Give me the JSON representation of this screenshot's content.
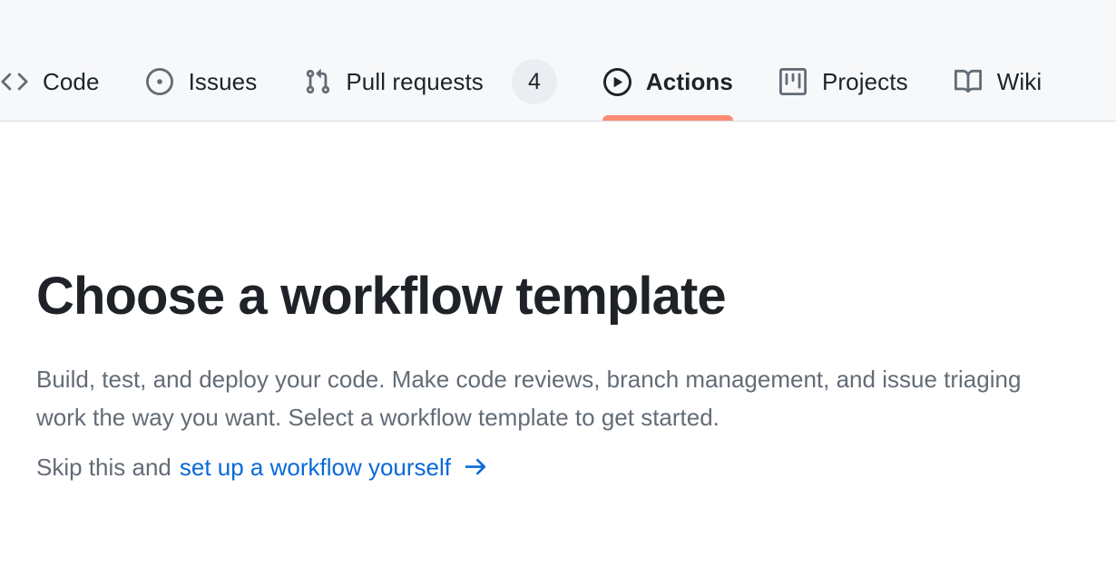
{
  "repo_nav": {
    "tabs": [
      {
        "label": "Code",
        "icon": "code-icon",
        "active": false,
        "counter": null
      },
      {
        "label": "Issues",
        "icon": "issue-opened-icon",
        "active": false,
        "counter": null
      },
      {
        "label": "Pull requests",
        "icon": "git-pull-request-icon",
        "active": false,
        "counter": "4"
      },
      {
        "label": "Actions",
        "icon": "play-circle-icon",
        "active": true,
        "counter": null
      },
      {
        "label": "Projects",
        "icon": "project-board-icon",
        "active": false,
        "counter": null
      },
      {
        "label": "Wiki",
        "icon": "book-icon",
        "active": false,
        "counter": null
      }
    ]
  },
  "main": {
    "title": "Choose a workflow template",
    "description": "Build, test, and deploy your code. Make code reviews, branch management, and issue triaging work the way you want. Select a workflow template to get started.",
    "skip_prefix": "Skip this and",
    "skip_link_label": "set up a workflow yourself",
    "skip_arrow_icon": "arrow-right-icon"
  },
  "colors": {
    "header_bg": "#f6f8fa",
    "header_border": "#d8dee4",
    "active_underline": "#fd8c73",
    "link_blue": "#0969da",
    "text_primary": "#1f2328",
    "text_muted": "#636c76",
    "counter_bg": "#eaeef2"
  }
}
